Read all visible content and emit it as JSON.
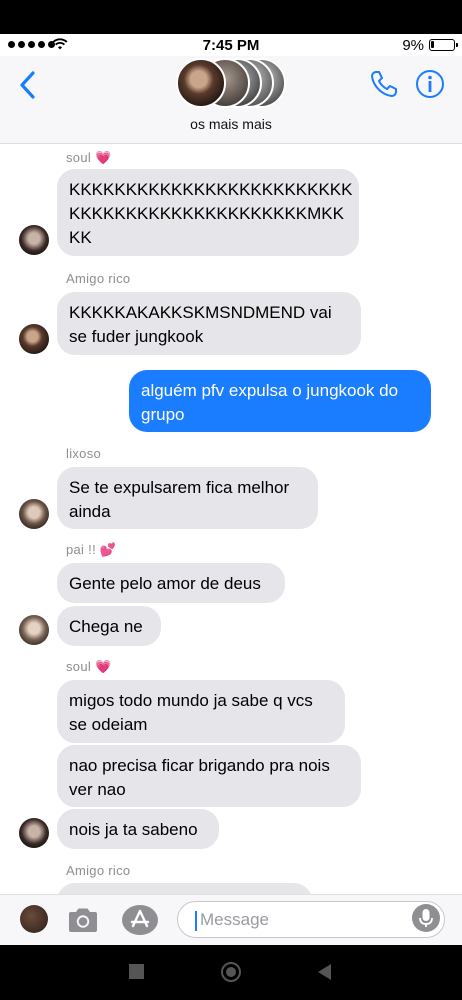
{
  "status": {
    "time": "7:45 PM",
    "battery": "9%"
  },
  "header": {
    "group_name": "os mais mais",
    "back_icon": "chevron-left-icon",
    "call_icon": "phone-icon",
    "info_icon": "info-icon"
  },
  "messages": [
    {
      "sender": "soul",
      "sender_emoji": "💗"
    },
    {
      "text": "KKKKKKKKKKKKKKKKKKKKKKKKKKKKKKKKKKKKKKKKKKKKMKKKK"
    },
    {
      "sender": "Amigo rico"
    },
    {
      "text": "KKKKKAKAKKSKMSNDMEND vai se fuder jungkook"
    },
    {
      "text": "alguém pfv expulsa o jungkook do grupo",
      "outgoing": true
    },
    {
      "sender": "lixoso"
    },
    {
      "text": "Se te expulsarem fica melhor ainda"
    },
    {
      "sender": "pai !!",
      "sender_emoji": "💕"
    },
    {
      "text": "Gente pelo amor de deus"
    },
    {
      "text": "Chega ne"
    },
    {
      "sender": "soul",
      "sender_emoji": "💗"
    },
    {
      "text": "migos todo mundo ja sabe q vcs se odeiam"
    },
    {
      "text": "nao precisa ficar brigando pra nois ver nao"
    },
    {
      "text": "nois ja ta sabeno"
    },
    {
      "sender": "Amigo rico"
    }
  ],
  "bubbles": {
    "b1_line1": "KKKKKKKKKKKKKKKKKKKKKKKKK",
    "b1_line2": "KKKKKKKKKKKKKKKKKKKKKMKK",
    "b1_line3": "KK",
    "b2_line1": "KKKKKAKAKKSKMSNDMEND vai",
    "b2_line2": "se fuder jungkook",
    "b3_line1": "alguém pfv expulsa o jungkook do",
    "b3_line2": "grupo",
    "b4_line1": "Se te expulsarem fica melhor",
    "b4_line2": "ainda",
    "b5": "Gente pelo amor de deus",
    "b6": "Chega ne",
    "b7_line1": "migos todo mundo ja sabe q vcs",
    "b7_line2": "se odeiam",
    "b8_line1": "nao precisa ficar brigando pra nois",
    "b8_line2": "ver nao",
    "b9": "nois ja ta sabeno"
  },
  "senders": {
    "s1": "soul",
    "s1_emoji": "💗",
    "s2": "Amigo rico",
    "s3": "lixoso",
    "s4": "pai !!",
    "s4_emoji": "💕",
    "s5": "soul",
    "s5_emoji": "💗",
    "s6": "Amigo rico"
  },
  "input": {
    "placeholder": "Message",
    "camera_icon": "camera-icon",
    "apps_icon": "app-store-icon",
    "mic_icon": "microphone-icon"
  },
  "colors": {
    "accent": "#1a7cff",
    "incoming_bubble": "#e5e5ea",
    "sender_label": "#8e8e93"
  }
}
